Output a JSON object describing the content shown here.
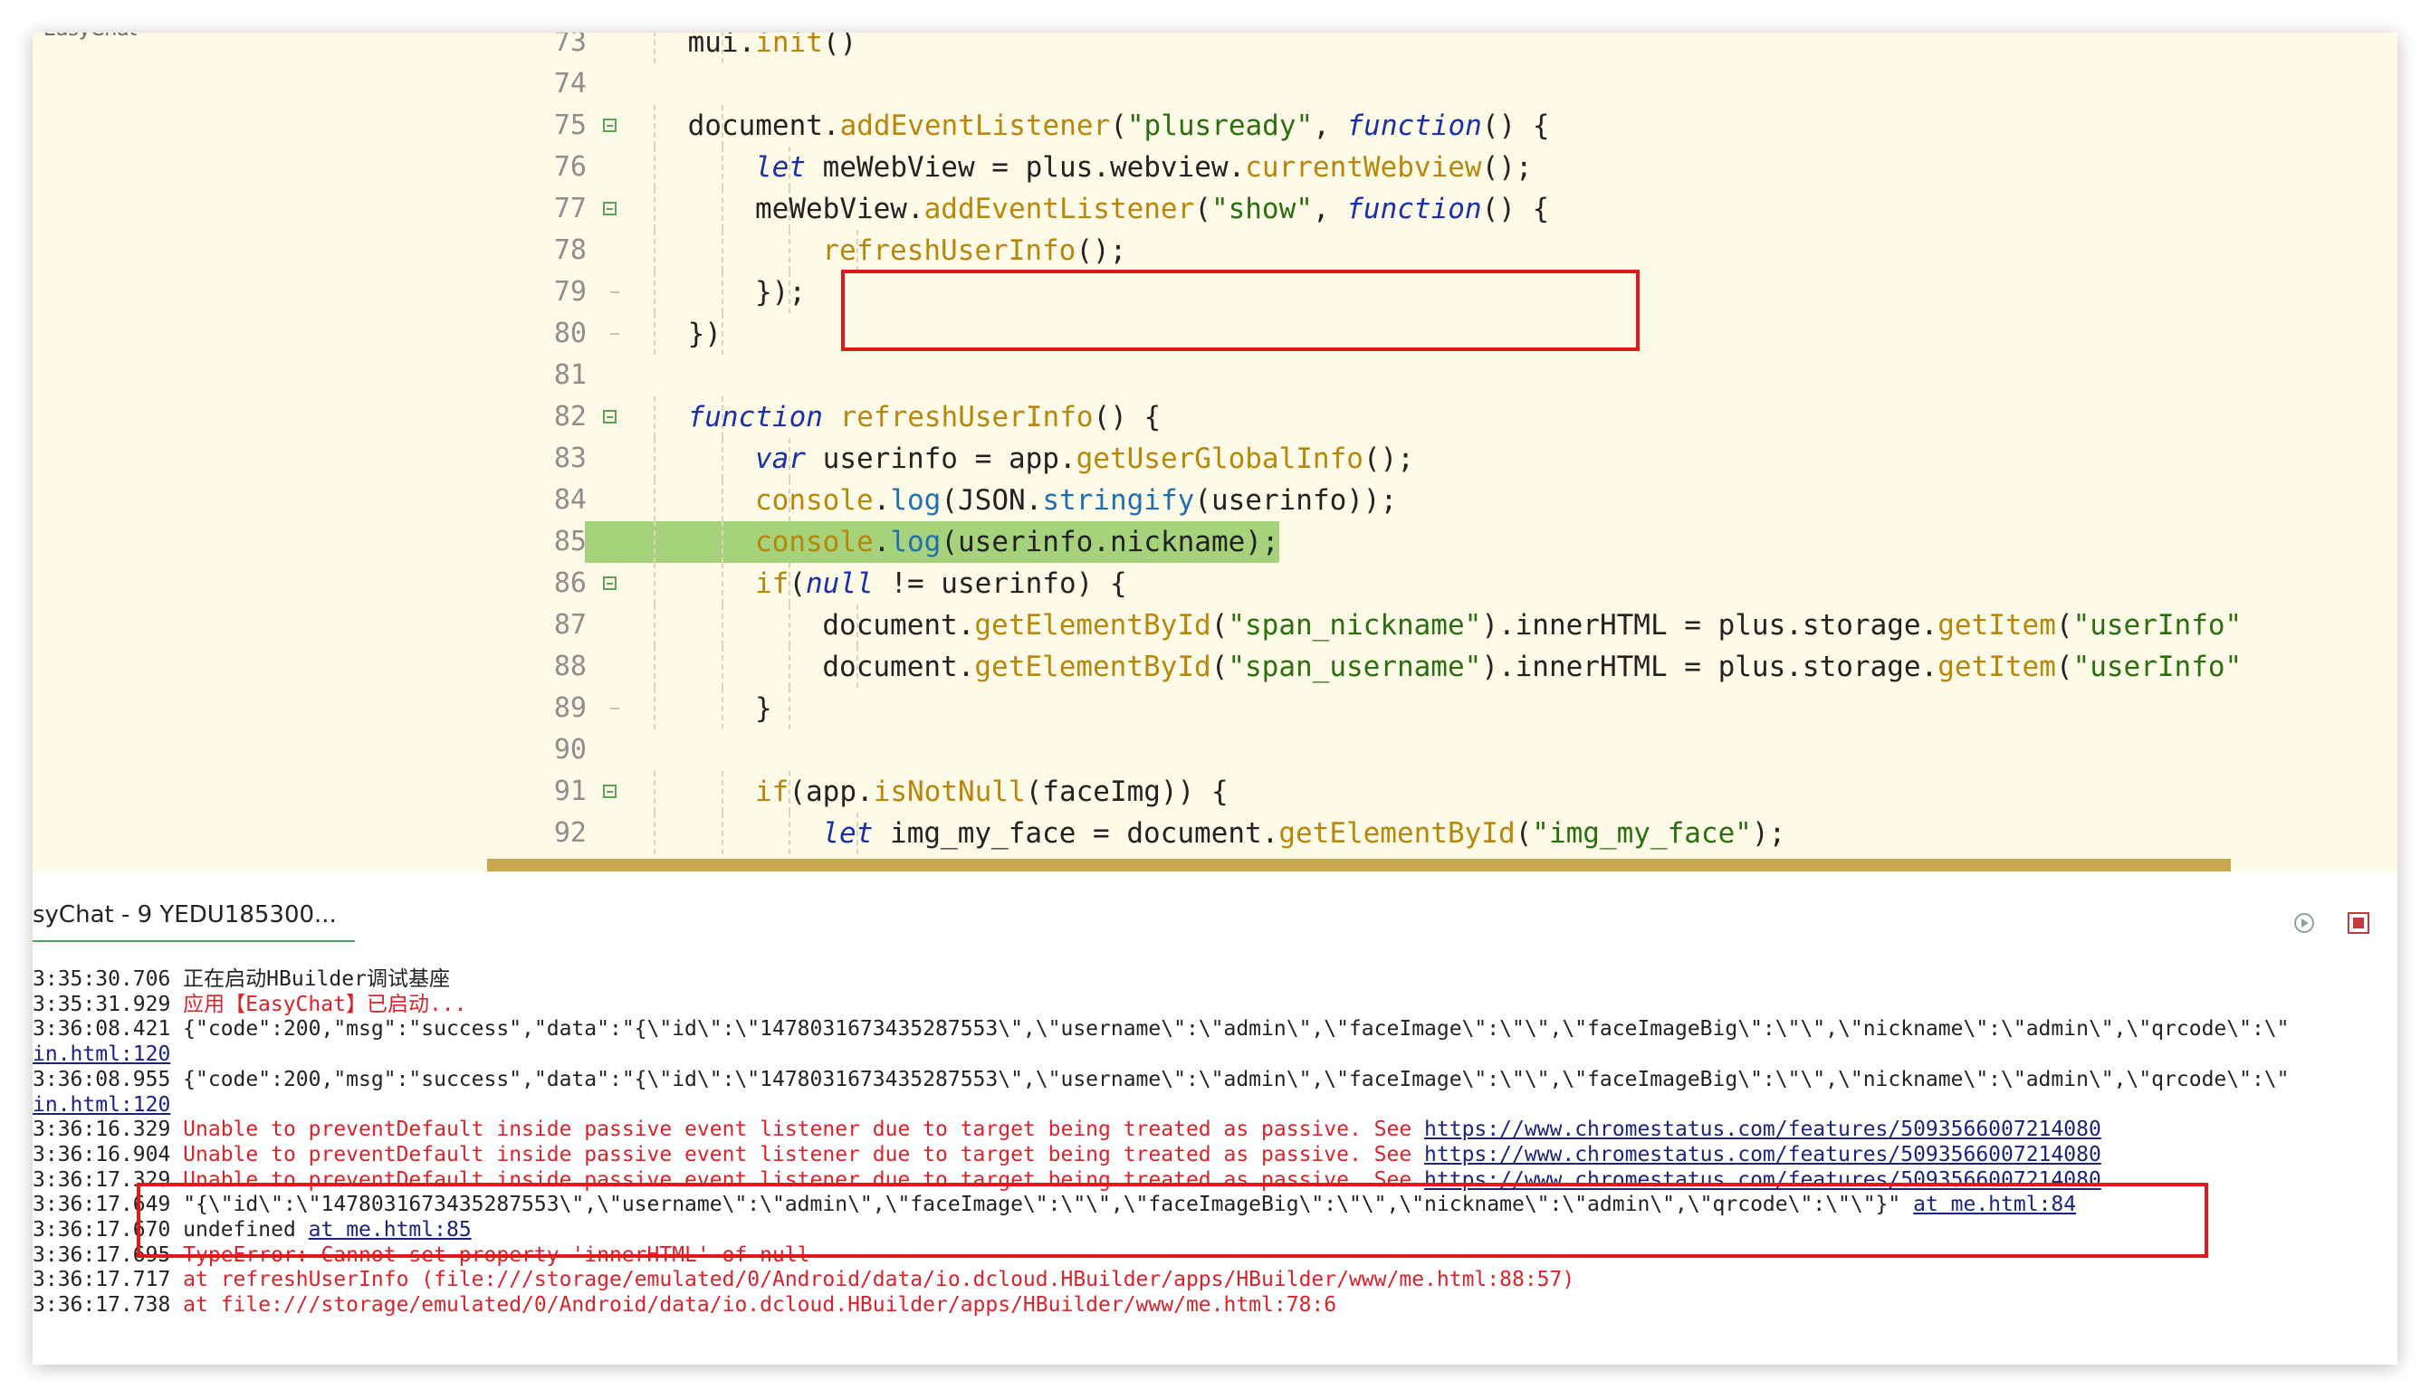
{
  "window": {
    "left_panel_title": "EasyChat"
  },
  "editor": {
    "lines": [
      {
        "num": "73",
        "fold": "none",
        "indent": 3,
        "tokens": [
          [
            "id",
            "mui."
          ],
          [
            "fn",
            "init"
          ],
          [
            "id",
            "()"
          ]
        ]
      },
      {
        "num": "74",
        "fold": "none",
        "indent": 0,
        "tokens": []
      },
      {
        "num": "75",
        "fold": "open",
        "indent": 3,
        "tokens": [
          [
            "id",
            "document."
          ],
          [
            "fn",
            "addEventListener"
          ],
          [
            "id",
            "("
          ],
          [
            "str",
            "\"plusready\""
          ],
          [
            "id",
            ", "
          ],
          [
            "kw",
            "function"
          ],
          [
            "id",
            "() {"
          ]
        ]
      },
      {
        "num": "76",
        "fold": "none",
        "indent": 4,
        "tokens": [
          [
            "kw",
            "let"
          ],
          [
            "id",
            " meWebView = plus.webview."
          ],
          [
            "fn",
            "currentWebview"
          ],
          [
            "id",
            "();"
          ]
        ]
      },
      {
        "num": "77",
        "fold": "open",
        "indent": 4,
        "tokens": [
          [
            "id",
            "meWebView."
          ],
          [
            "fn",
            "addEventListener"
          ],
          [
            "id",
            "("
          ],
          [
            "str",
            "\"show\""
          ],
          [
            "id",
            ", "
          ],
          [
            "kw",
            "function"
          ],
          [
            "id",
            "() {"
          ]
        ]
      },
      {
        "num": "78",
        "fold": "none",
        "indent": 5,
        "tokens": [
          [
            "fn",
            "refreshUserInfo"
          ],
          [
            "id",
            "();"
          ]
        ]
      },
      {
        "num": "79",
        "fold": "end",
        "indent": 4,
        "tokens": [
          [
            "id",
            "});"
          ]
        ]
      },
      {
        "num": "80",
        "fold": "end",
        "indent": 3,
        "tokens": [
          [
            "id",
            "})"
          ]
        ]
      },
      {
        "num": "81",
        "fold": "none",
        "indent": 0,
        "tokens": []
      },
      {
        "num": "82",
        "fold": "open",
        "indent": 3,
        "tokens": [
          [
            "kw",
            "function"
          ],
          [
            "id",
            " "
          ],
          [
            "fn",
            "refreshUserInfo"
          ],
          [
            "id",
            "() {"
          ]
        ]
      },
      {
        "num": "83",
        "fold": "none",
        "indent": 4,
        "tokens": [
          [
            "kw",
            "var"
          ],
          [
            "id",
            " userinfo = app."
          ],
          [
            "fn",
            "getUserGlobalInfo"
          ],
          [
            "id",
            "();"
          ]
        ]
      },
      {
        "num": "84",
        "fold": "none",
        "indent": 4,
        "tokens": [
          [
            "fn",
            "console"
          ],
          [
            "id",
            "."
          ],
          [
            "m",
            "log"
          ],
          [
            "id",
            "(JSON."
          ],
          [
            "m",
            "stringify"
          ],
          [
            "id",
            "(userinfo));"
          ]
        ]
      },
      {
        "num": "85",
        "fold": "none",
        "indent": 4,
        "highlight": true,
        "tokens": [
          [
            "fn",
            "console"
          ],
          [
            "id",
            "."
          ],
          [
            "m",
            "log"
          ],
          [
            "id",
            "(userinfo.nickname);"
          ]
        ]
      },
      {
        "num": "86",
        "fold": "open",
        "indent": 4,
        "tokens": [
          [
            "fn",
            "if"
          ],
          [
            "id",
            "("
          ],
          [
            "kw",
            "null"
          ],
          [
            "id",
            " != userinfo) {"
          ]
        ]
      },
      {
        "num": "87",
        "fold": "none",
        "indent": 5,
        "tokens": [
          [
            "id",
            "document."
          ],
          [
            "fn",
            "getElementById"
          ],
          [
            "id",
            "("
          ],
          [
            "str",
            "\"span_nickname\""
          ],
          [
            "id",
            ").innerHTML = plus.storage."
          ],
          [
            "fn",
            "getItem"
          ],
          [
            "id",
            "("
          ],
          [
            "str",
            "\"userInfo\""
          ]
        ]
      },
      {
        "num": "88",
        "fold": "none",
        "indent": 5,
        "tokens": [
          [
            "id",
            "document."
          ],
          [
            "fn",
            "getElementById"
          ],
          [
            "id",
            "("
          ],
          [
            "str",
            "\"span_username\""
          ],
          [
            "id",
            ").innerHTML = plus.storage."
          ],
          [
            "fn",
            "getItem"
          ],
          [
            "id",
            "("
          ],
          [
            "str",
            "\"userInfo\""
          ]
        ]
      },
      {
        "num": "89",
        "fold": "end",
        "indent": 4,
        "tokens": [
          [
            "id",
            "}"
          ]
        ]
      },
      {
        "num": "90",
        "fold": "none",
        "indent": 0,
        "tokens": []
      },
      {
        "num": "91",
        "fold": "open",
        "indent": 4,
        "tokens": [
          [
            "fn",
            "if"
          ],
          [
            "id",
            "(app."
          ],
          [
            "fn",
            "isNotNull"
          ],
          [
            "id",
            "(faceImg)) {"
          ]
        ]
      },
      {
        "num": "92",
        "fold": "none",
        "indent": 5,
        "tokens": [
          [
            "kw",
            "let"
          ],
          [
            "id",
            " img_my_face = document."
          ],
          [
            "fn",
            "getElementById"
          ],
          [
            "id",
            "("
          ],
          [
            "str",
            "\"img_my_face\""
          ],
          [
            "id",
            ");"
          ]
        ]
      }
    ]
  },
  "console": {
    "tab_label": "syChat - 9 YEDU185300...",
    "restart_icon": "restart-icon",
    "stop_icon": "stop-icon",
    "lines": [
      {
        "ts": "3:35:30.706",
        "type": "info",
        "text": "正在启动HBuilder调试基座",
        "link": ""
      },
      {
        "ts": "3:35:31.929",
        "type": "err",
        "text": "应用【EasyChat】已启动...",
        "link": ""
      },
      {
        "ts": "3:36:08.421",
        "type": "info",
        "text": "{\"code\":200,\"msg\":\"success\",\"data\":\"{\\\"id\\\":\\\"1478031673435287553\\\",\\\"username\\\":\\\"admin\\\",\\\"faceImage\\\":\\\"\\\",\\\"faceImageBig\\\":\\\"\\\",\\\"nickname\\\":\\\"admin\\\",\\\"qrcode\\\":\\\"",
        "link": ""
      },
      {
        "ts": "",
        "type": "info",
        "text": "",
        "link": "in.html:120"
      },
      {
        "ts": "3:36:08.955",
        "type": "info",
        "text": "{\"code\":200,\"msg\":\"success\",\"data\":\"{\\\"id\\\":\\\"1478031673435287553\\\",\\\"username\\\":\\\"admin\\\",\\\"faceImage\\\":\\\"\\\",\\\"faceImageBig\\\":\\\"\\\",\\\"nickname\\\":\\\"admin\\\",\\\"qrcode\\\":\\\"",
        "link": ""
      },
      {
        "ts": "",
        "type": "info",
        "text": "",
        "link": "in.html:120"
      },
      {
        "ts": "3:36:16.329",
        "type": "err",
        "text": "Unable to preventDefault inside passive event listener due to target being treated as passive. See ",
        "link": "https://www.chromestatus.com/features/5093566007214080"
      },
      {
        "ts": "3:36:16.904",
        "type": "err",
        "text": "Unable to preventDefault inside passive event listener due to target being treated as passive. See ",
        "link": "https://www.chromestatus.com/features/5093566007214080"
      },
      {
        "ts": "3:36:17.329",
        "type": "err",
        "text": "Unable to preventDefault inside passive event listener due to target being treated as passive. See ",
        "link": "https://www.chromestatus.com/features/5093566007214080"
      },
      {
        "ts": "3:36:17.649",
        "type": "info",
        "text": "\"{\\\"id\\\":\\\"1478031673435287553\\\",\\\"username\\\":\\\"admin\\\",\\\"faceImage\\\":\\\"\\\",\\\"faceImageBig\\\":\\\"\\\",\\\"nickname\\\":\\\"admin\\\",\\\"qrcode\\\":\\\"\\\"}\" ",
        "link": "at me.html:84"
      },
      {
        "ts": "3:36:17.670",
        "type": "info",
        "text": "undefined ",
        "link": "at me.html:85"
      },
      {
        "ts": "3:36:17.695",
        "type": "err",
        "text": "TypeError: Cannot set property 'innerHTML' of null",
        "link": ""
      },
      {
        "ts": "3:36:17.717",
        "type": "err",
        "text": "at refreshUserInfo (file:///storage/emulated/0/Android/data/io.dcloud.HBuilder/apps/HBuilder/www/me.html:88:57)",
        "link": ""
      },
      {
        "ts": "3:36:17.738",
        "type": "err",
        "text": "at file:///storage/emulated/0/Android/data/io.dcloud.HBuilder/apps/HBuilder/www/me.html:78:6",
        "link": ""
      }
    ]
  },
  "colors": {
    "annotation_box": "#e01a1a",
    "line_highlight": "#a5d27a",
    "editor_bg": "#fdfbe8"
  }
}
